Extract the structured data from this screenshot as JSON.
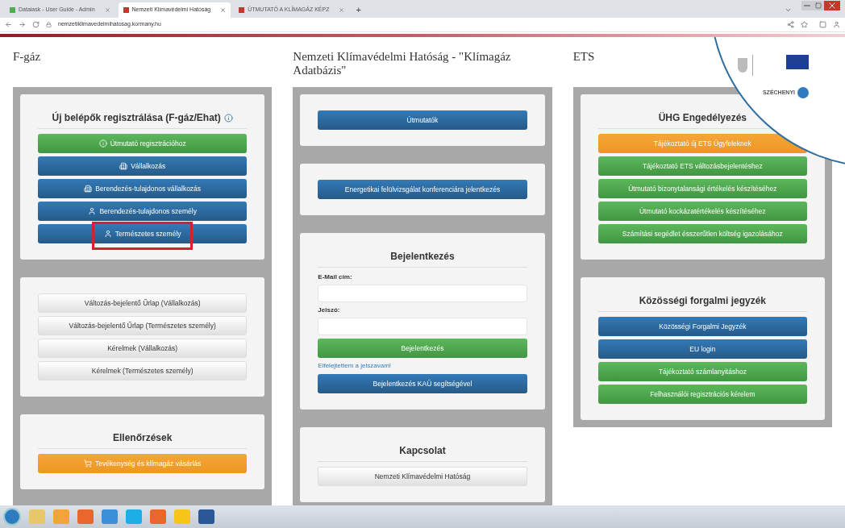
{
  "browser": {
    "tabs": [
      {
        "title": "Dataiask - User Guide - Admin",
        "selected": false
      },
      {
        "title": "Nemzeti Klímavédelmi Hatóság",
        "selected": true
      },
      {
        "title": "ÚTMUTATÓ A KLÍMAGÁZ KÉPZ",
        "selected": false
      }
    ],
    "new_tab": "+",
    "url": "nemzetiklimavedelmihatosag.kormany.hu"
  },
  "columns": [
    {
      "heading": "F-gáz",
      "panels": [
        {
          "title": "Új belépők regisztrálása (F-gáz/Ehat)",
          "title_info": true,
          "items": [
            {
              "kind": "green",
              "label": "Útmutató regisztrációhoz"
            },
            {
              "kind": "blue",
              "label": "Vállalkozás"
            },
            {
              "kind": "blue",
              "label": "Berendezés-tulajdonos vállalkozás"
            },
            {
              "kind": "blue",
              "label": "Berendezés-tulajdonos személy"
            },
            {
              "kind": "blue",
              "label": "Természetes személy",
              "highlighted": true
            }
          ]
        },
        {
          "items": [
            {
              "kind": "white",
              "label": "Változás-bejelentő Űrlap (Vállalkozás)"
            },
            {
              "kind": "white",
              "label": "Változás-bejelentő Űrlap (Természetes személy)"
            },
            {
              "kind": "white",
              "label": "Kérelmek (Vállalkozás)"
            },
            {
              "kind": "white",
              "label": "Kérelmek (Természetes személy)"
            }
          ]
        },
        {
          "title": "Ellenőrzések",
          "items": [
            {
              "kind": "orange",
              "label": "Tevékenység és klímagáz vásárlás"
            }
          ]
        }
      ]
    },
    {
      "heading": "Nemzeti Klímavédelmi Hatóság - \"Klímagáz Adatbázis\"",
      "panels": [
        {
          "items": [
            {
              "kind": "blue",
              "label": "Útmutatók"
            }
          ]
        },
        {
          "items": [
            {
              "kind": "blue",
              "label": "Energetikai felülvizsgálat konferenciára jelentkezés"
            }
          ]
        },
        {
          "title": "Bejelentkezés",
          "items": [
            {
              "kind": "field",
              "label": "E-Mail cím:"
            },
            {
              "kind": "field",
              "label": "Jelszó:"
            },
            {
              "kind": "green",
              "label": "Bejelentkezés"
            },
            {
              "kind": "link",
              "label": "Elfelejtettem a jelszavam!"
            },
            {
              "kind": "blue",
              "label": "Bejelentkezés KAÜ segítségével"
            }
          ]
        },
        {
          "title": "Kapcsolat",
          "items": [
            {
              "kind": "white",
              "label": "Nemzeti Klímavédelmi Hatóság"
            }
          ]
        }
      ]
    },
    {
      "heading": "ETS",
      "panels": [
        {
          "title": "ÜHG Engedélyezés",
          "items": [
            {
              "kind": "orange",
              "label": "Tájékoztató új ETS Ügyfeleknek"
            },
            {
              "kind": "green",
              "label": "Tájékoztató ETS változásbejelentéshez"
            },
            {
              "kind": "green",
              "label": "Útmutató bizonytalansági értékelés készítéséhez"
            },
            {
              "kind": "green",
              "label": "Útmutató kockázatértékelés készítéséhez"
            },
            {
              "kind": "green",
              "label": "Számítási segédlet ésszerűtlen költség igazolásához"
            }
          ]
        },
        {
          "title": "Közösségi forgalmi jegyzék",
          "items": [
            {
              "kind": "blue",
              "label": "Közösségi Forgalmi Jegyzék"
            },
            {
              "kind": "blue",
              "label": "EU login"
            },
            {
              "kind": "green",
              "label": "Tájékoztató számlanyitáshoz"
            },
            {
              "kind": "green",
              "label": "Felhasználói regisztrációs kérelem"
            }
          ]
        }
      ]
    }
  ],
  "logo_badge": {
    "brand": "SZÉCHENYI"
  }
}
